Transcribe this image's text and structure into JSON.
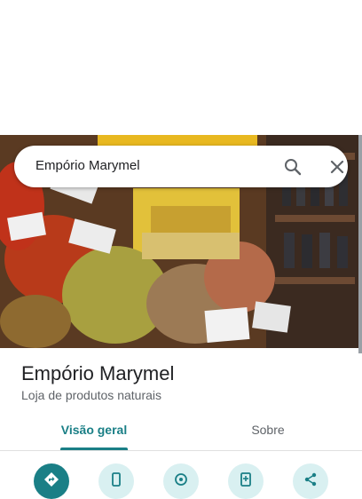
{
  "search": {
    "query": "Empório Marymel"
  },
  "place": {
    "name": "Empório Marymel",
    "category": "Loja de produtos naturais"
  },
  "tabs": [
    {
      "label": "Visão geral",
      "selected": true
    },
    {
      "label": "Sobre",
      "selected": false
    }
  ],
  "actions": [
    {
      "icon": "directions-icon"
    },
    {
      "icon": "phone-icon"
    },
    {
      "icon": "nearby-icon"
    },
    {
      "icon": "save-to-phone-icon"
    },
    {
      "icon": "share-icon"
    }
  ],
  "colors": {
    "accent": "#1a7f86",
    "accent_light": "#d9f0f1"
  }
}
